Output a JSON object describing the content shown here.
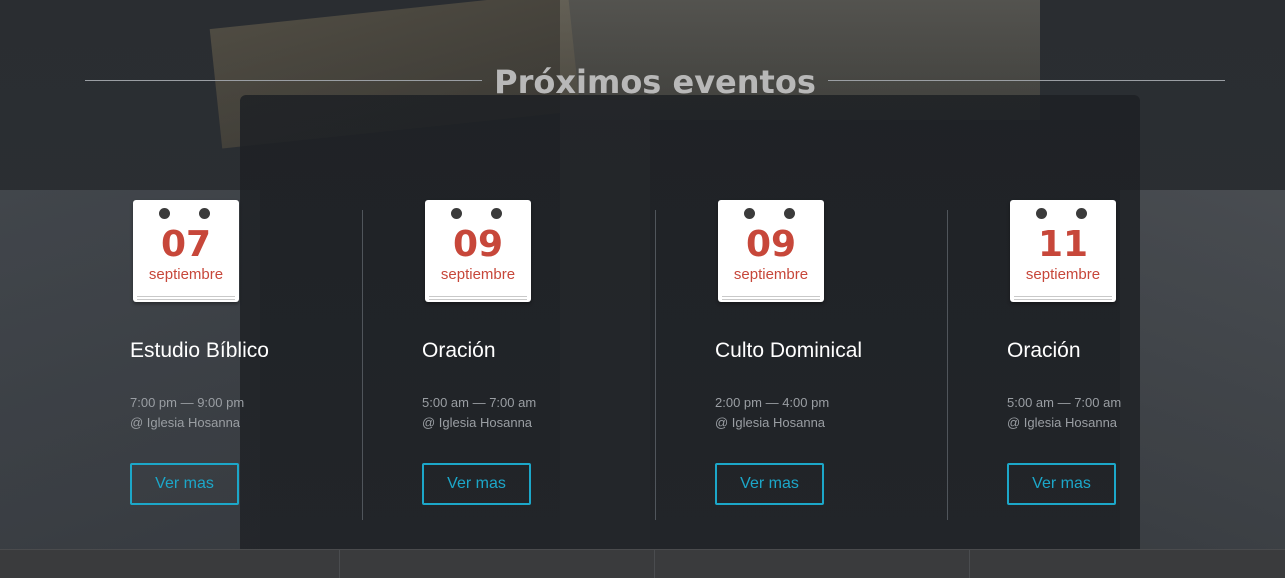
{
  "section": {
    "title": "Próximos eventos"
  },
  "events": [
    {
      "day": "07",
      "month": "septiembre",
      "title": "Estudio Bíblico",
      "time": "7:00 pm — 9:00 pm",
      "place": "@ Iglesia Hosanna",
      "button": "Ver mas"
    },
    {
      "day": "09",
      "month": "septiembre",
      "title": "Oración",
      "time": "5:00 am — 7:00 am",
      "place": "@ Iglesia Hosanna",
      "button": "Ver mas"
    },
    {
      "day": "09",
      "month": "septiembre",
      "title": "Culto Dominical",
      "time": "2:00 pm — 4:00 pm",
      "place": "@ Iglesia Hosanna",
      "button": "Ver mas"
    },
    {
      "day": "11",
      "month": "septiembre",
      "title": "Oración",
      "time": "5:00 am — 7:00 am",
      "place": "@ Iglesia Hosanna",
      "button": "Ver mas"
    }
  ],
  "colors": {
    "accent": "#1ca7c9",
    "calendar_date": "#c7473a",
    "background": "#2b2e33"
  },
  "icons": {
    "calendar": "calendar-icon"
  }
}
